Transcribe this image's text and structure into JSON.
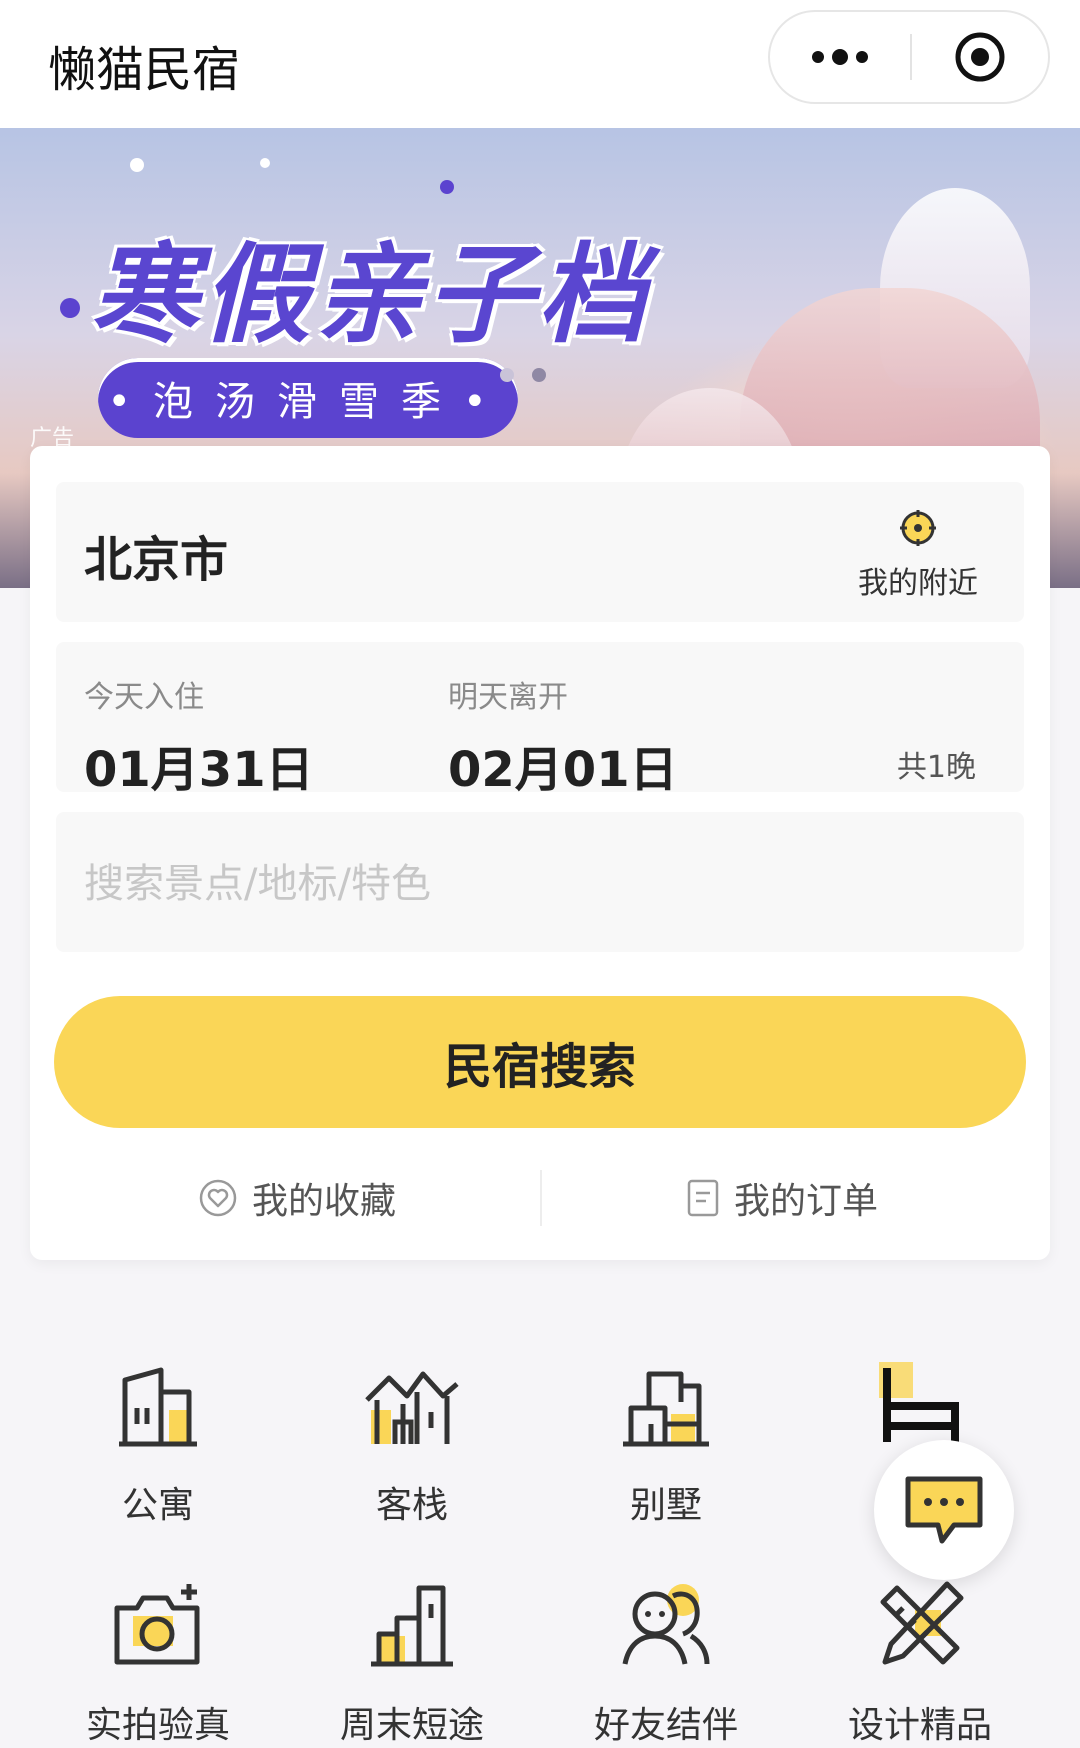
{
  "app": {
    "title": "懒猫民宿",
    "capsule": {
      "more_icon": "more-dots-icon",
      "close_icon": "target-close-icon"
    }
  },
  "banner": {
    "headline": "寒假亲子档",
    "subline": "•泡汤滑雪季•",
    "ad_tag": "广告",
    "page_count": 2,
    "current_page": 1
  },
  "search": {
    "city": "北京市",
    "nearby_label": "我的附近",
    "checkin_caption": "今天入住",
    "checkin_date": "01月31日",
    "checkout_caption": "明天离开",
    "checkout_date": "02月01日",
    "nights": "共1晚",
    "keyword_placeholder": "搜索景点/地标/特色",
    "search_button": "民宿搜索",
    "favorites_label": "我的收藏",
    "orders_label": "我的订单"
  },
  "categories": [
    {
      "label": "公寓",
      "icon": "apartment-icon"
    },
    {
      "label": "客栈",
      "icon": "inn-icon"
    },
    {
      "label": "别墅",
      "icon": "villa-icon"
    },
    {
      "label": "",
      "icon": "bed-icon"
    },
    {
      "label": "实拍验真",
      "icon": "camera-icon"
    },
    {
      "label": "周末短途",
      "icon": "short-trip-icon"
    },
    {
      "label": "好友结伴",
      "icon": "friends-icon"
    },
    {
      "label": "设计精品",
      "icon": "design-icon"
    }
  ],
  "floating": {
    "icon": "chat-bubble-icon"
  },
  "colors": {
    "accent": "#fad657",
    "banner_purple": "#5b43cf",
    "text_dark": "#222222"
  }
}
